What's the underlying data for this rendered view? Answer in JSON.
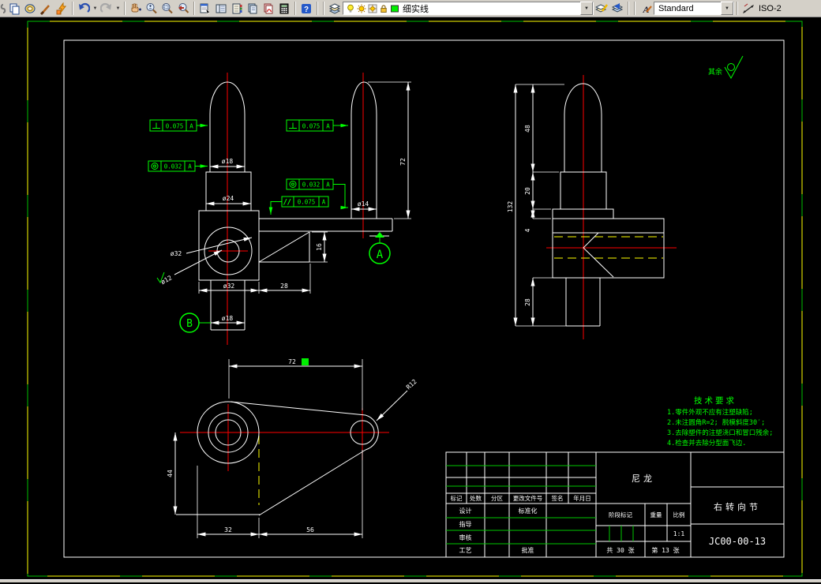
{
  "toolbar": {
    "layer_combo": {
      "value": "细实线",
      "swatch_color": "#00ff00"
    },
    "text_style_combo": {
      "value": "Standard"
    },
    "dim_style_label": "ISO-2",
    "icons": [
      "copy",
      "paste",
      "match-properties",
      "lightning",
      "undo",
      "undo-dropdown",
      "redo",
      "redo-dropdown",
      "pan",
      "zoom-realtime",
      "zoom-window",
      "zoom-previous",
      "properties",
      "design-center",
      "tool-palettes",
      "sheet-set-manager",
      "markup-set-manager",
      "quick-calc",
      "help",
      "layers",
      "bulb",
      "sun",
      "sun-viewport",
      "lock",
      "color-swatch",
      "layer-dropdown",
      "make-object-layer-current",
      "layer-previous",
      "text-style",
      "dim-style"
    ]
  },
  "drawing": {
    "surface_note": "其余",
    "front_view": {
      "dim_stem": "ø18",
      "dim_boss": "ø24",
      "leader_bore": "ø32",
      "leader_hole": "ø12",
      "dim_body": "ø32",
      "dim_offset": "28",
      "dim_lower_stem": "ø18",
      "dim_rib": "16"
    },
    "mid_view": {
      "dim_pin": "ø14",
      "dim_height": "72"
    },
    "side_view": {
      "dim_total": "132",
      "dim_upper": "48",
      "dim_block": "20",
      "dim_flange": "4",
      "dim_lower": "28"
    },
    "bottom_view": {
      "dim_span": "72",
      "dim_height": "44",
      "dim_left": "32",
      "dim_right": "56",
      "leader_radius": "R12"
    },
    "datum_a": "A",
    "datum_b": "B",
    "fcf": [
      {
        "symbol": "perpendicularity",
        "value": "0.075",
        "datum": "A"
      },
      {
        "symbol": "concentricity",
        "value": "0.032",
        "datum": "A"
      },
      {
        "symbol": "perpendicularity",
        "value": "0.075",
        "datum": "A"
      },
      {
        "symbol": "concentricity",
        "value": "0.032",
        "datum": "A"
      },
      {
        "symbol": "parallelism",
        "value": "0.075",
        "datum": "A"
      }
    ]
  },
  "tech_requirements": {
    "title": "技术要求",
    "lines": [
      "1.零件外观不应有注塑缺陷;",
      "2.未注圆角R=2; 脱模斜度30′;",
      "3.去除塑件的注塑浇口和冒口残余;",
      "4.检查并去除分型面飞边."
    ]
  },
  "title_block": {
    "rev_headers": [
      "标记",
      "处数",
      "分区",
      "更改文件号",
      "签名",
      "年月日"
    ],
    "row_labels": [
      "设计",
      "指导",
      "审核",
      "工艺"
    ],
    "std_label": "标准化",
    "approve_label": "批准",
    "material": "尼龙",
    "stage_label": "阶段标记",
    "weight_label": "重量",
    "scale_label": "比例",
    "scale_value": "1:1",
    "sheet_total": "共 30 张",
    "sheet_index": "第 13 张",
    "part_name": "右转向节",
    "drawing_no": "JC00-00-13"
  },
  "colors": {
    "line": "#ffffff",
    "annotation": "#00ff00",
    "centerline": "#ff0000",
    "hidden": "#ffff00",
    "border_outer": "#ffff00",
    "border_dash": "#00c000",
    "canvas": "#000000",
    "toolbar_bg": "#d4d0c8"
  }
}
